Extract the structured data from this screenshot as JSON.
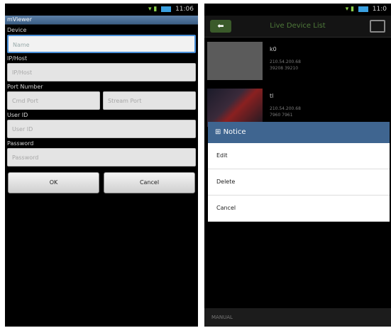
{
  "left": {
    "status": "11:06",
    "app_title": "mViewer",
    "labels": {
      "device": "Device",
      "host": "IP/Host",
      "port": "Port Number",
      "user": "User ID",
      "password": "Password"
    },
    "placeholders": {
      "name": "Name",
      "host": "IP/Host",
      "cmd_port": "Cmd Port",
      "stream_port": "Stream Port",
      "user": "User ID",
      "password": "Password"
    },
    "buttons": {
      "ok": "OK",
      "cancel": "Cancel"
    }
  },
  "right": {
    "status": "11:0",
    "title": "Live Device List",
    "devices": [
      {
        "name": "k0",
        "info1": "210.54.200.68",
        "info2": "39208 39210"
      },
      {
        "name": "tl",
        "info1": "210.54.200.68",
        "info2": "7960 7961"
      }
    ],
    "dialog": {
      "title": "Notice",
      "items": [
        "Edit",
        "Delete",
        "Cancel"
      ]
    },
    "bottom": "MANUAL"
  }
}
